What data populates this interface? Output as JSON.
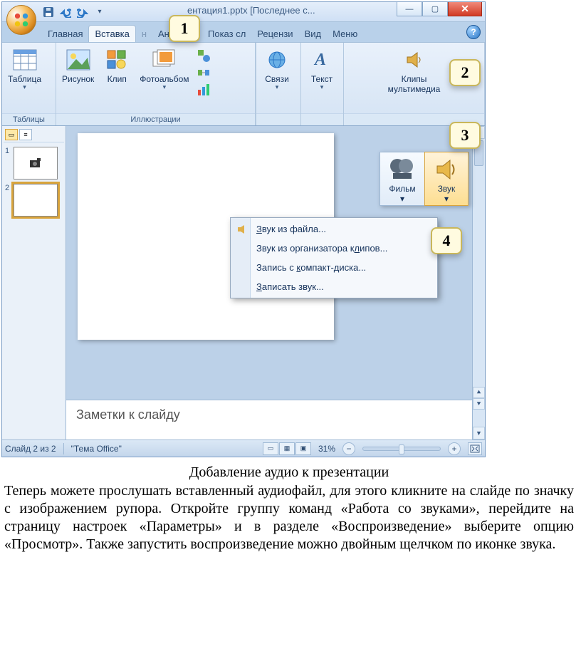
{
  "window": {
    "title": "ентация1.pptx [Последнее с..."
  },
  "tabs": {
    "items": [
      "Главная",
      "Вставка",
      "н",
      "Анимаци",
      "Показ сл",
      "Рецензи",
      "Вид",
      "Меню"
    ],
    "activeIndex": 1
  },
  "ribbon": {
    "groups": {
      "tables": {
        "label": "Таблицы",
        "btn": "Таблица"
      },
      "illustrations": {
        "label": "Иллюстрации",
        "picture": "Рисунок",
        "clip": "Клип",
        "album": "Фотоальбом"
      },
      "links": {
        "btn": "Связи"
      },
      "text": {
        "btn": "Текст"
      },
      "media": {
        "btn": "Клипы\nмультимедиа"
      }
    }
  },
  "mediaPopup": {
    "movie": "Фильм",
    "sound": "Звук"
  },
  "ddMenu": {
    "items": [
      "Звук из файла...",
      "Звук из организатора клипов...",
      "Запись с компакт-диска...",
      "Записать звук..."
    ]
  },
  "thumbs": {
    "n1": "1",
    "n2": "2"
  },
  "notes": {
    "placeholder": "Заметки к слайду"
  },
  "status": {
    "slide": "Слайд 2 из 2",
    "theme": "\"Тема Office\"",
    "zoom": "31%"
  },
  "callouts": {
    "c1": "1",
    "c2": "2",
    "c3": "3",
    "c4": "4"
  },
  "doc": {
    "caption": "Добавление аудио к презентации",
    "para": "Теперь можете прослушать вставленный аудиофайл, для этого кликните на слайде по значку с изображением рупора. Откройте группу команд «Работа со звуками», перейдите на страницу настроек «Параметры» и в разделе «Воспроизведение» выберите опцию «Просмотр». Также запустить воспроизведение можно двойным щелчком по иконке звука."
  }
}
